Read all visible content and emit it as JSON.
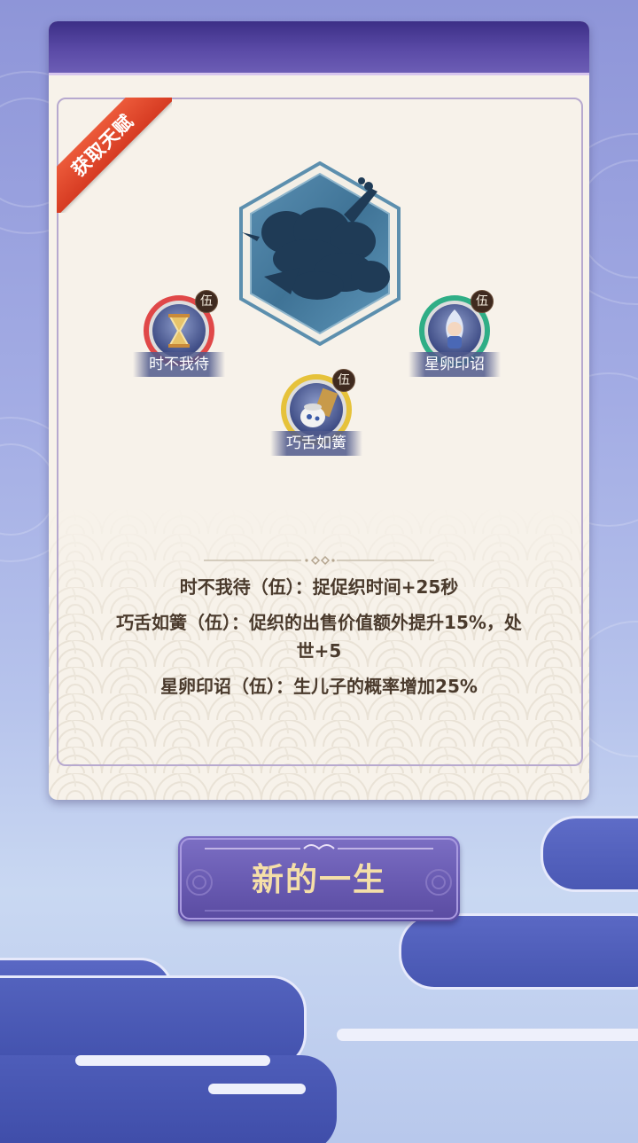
{
  "ribbon": {
    "label": "获取天赋"
  },
  "talents": [
    {
      "name": "时不我待",
      "level": "伍",
      "ring_color": "#e04848",
      "icon": "hourglass-icon"
    },
    {
      "name": "星卵印诏",
      "level": "伍",
      "ring_color": "#2fae86",
      "icon": "child-figure-icon"
    },
    {
      "name": "巧舌如簧",
      "level": "伍",
      "ring_color": "#e6c23a",
      "icon": "teapot-icon"
    }
  ],
  "descriptions": {
    "line1": "时不我待（伍）：捉促织时间+25秒",
    "line2a": "巧舌如簧（伍）：促织的出售价值额外提升15%，处",
    "line2b": "世+5",
    "line3": "星卵印诏（伍）：生儿子的概率增加25%"
  },
  "button": {
    "label": "新的一生"
  },
  "colors": {
    "header": "#4a3b96",
    "panel": "#f7f2ea",
    "button": "#6a5cb3",
    "button_text": "#f5dfa8",
    "ribbon": "#e04a2e"
  }
}
